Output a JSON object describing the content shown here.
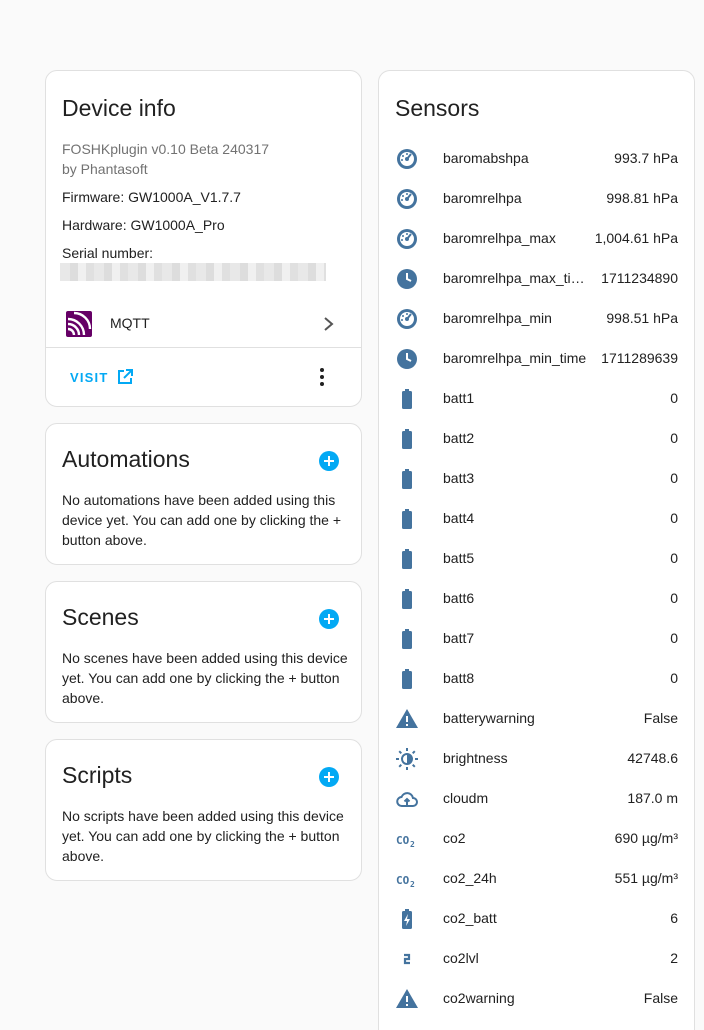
{
  "colors": {
    "accent": "#03a9f4",
    "icon": "#44739e",
    "mqtt": "#660066",
    "text": "#212121",
    "muted": "#727272"
  },
  "device_info": {
    "title": "Device info",
    "model": "FOSHKplugin v0.10 Beta 240317",
    "manufacturer": "by Phantasoft",
    "firmware": "Firmware: GW1000A_V1.7.7",
    "hardware": "Hardware: GW1000A_Pro",
    "serial_label": "Serial number:",
    "integration": "MQTT",
    "visit_label": "VISIT"
  },
  "automations": {
    "title": "Automations",
    "description": "No automations have been added using this device yet. You can add one by clicking the + button above."
  },
  "scenes": {
    "title": "Scenes",
    "description": "No scenes have been added using this device yet. You can add one by clicking the + button above."
  },
  "scripts": {
    "title": "Scripts",
    "description": "No scripts have been added using this device yet. You can add one by clicking the + button above."
  },
  "sensors": {
    "title": "Sensors",
    "items": [
      {
        "name": "baromabshpa",
        "value": "993.7 hPa",
        "icon": "gauge-icon"
      },
      {
        "name": "baromrelhpa",
        "value": "998.81 hPa",
        "icon": "gauge-icon"
      },
      {
        "name": "baromrelhpa_max",
        "value": "1,004.61 hPa",
        "icon": "gauge-icon"
      },
      {
        "name": "baromrelhpa_max_ti…",
        "value": "1711234890",
        "icon": "clock-icon"
      },
      {
        "name": "baromrelhpa_min",
        "value": "998.51 hPa",
        "icon": "gauge-icon"
      },
      {
        "name": "baromrelhpa_min_time",
        "value": "1711289639",
        "icon": "clock-icon"
      },
      {
        "name": "batt1",
        "value": "0",
        "icon": "battery-icon"
      },
      {
        "name": "batt2",
        "value": "0",
        "icon": "battery-icon"
      },
      {
        "name": "batt3",
        "value": "0",
        "icon": "battery-icon"
      },
      {
        "name": "batt4",
        "value": "0",
        "icon": "battery-icon"
      },
      {
        "name": "batt5",
        "value": "0",
        "icon": "battery-icon"
      },
      {
        "name": "batt6",
        "value": "0",
        "icon": "battery-icon"
      },
      {
        "name": "batt7",
        "value": "0",
        "icon": "battery-icon"
      },
      {
        "name": "batt8",
        "value": "0",
        "icon": "battery-icon"
      },
      {
        "name": "batterywarning",
        "value": "False",
        "icon": "alert-icon"
      },
      {
        "name": "brightness",
        "value": "42748.6",
        "icon": "brightness-icon"
      },
      {
        "name": "cloudm",
        "value": "187.0 m",
        "icon": "cloud-upload-icon"
      },
      {
        "name": "co2",
        "value": "690 µg/m³",
        "icon": "co2-icon"
      },
      {
        "name": "co2_24h",
        "value": "551 µg/m³",
        "icon": "co2-icon"
      },
      {
        "name": "co2_batt",
        "value": "6",
        "icon": "battery-charging-icon"
      },
      {
        "name": "co2lvl",
        "value": "2",
        "icon": "numeric-2-icon"
      },
      {
        "name": "co2warning",
        "value": "False",
        "icon": "alert-icon"
      }
    ]
  }
}
